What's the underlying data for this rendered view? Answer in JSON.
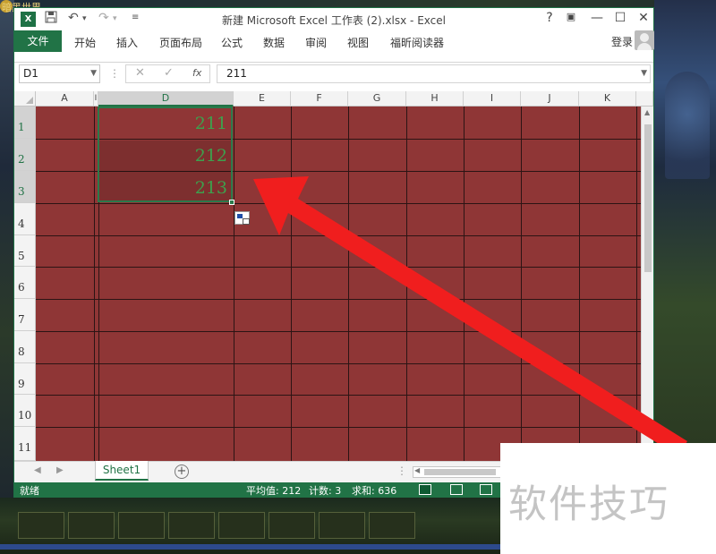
{
  "desktop": {
    "title_fragment": "暗黑世界"
  },
  "window": {
    "title": "新建 Microsoft Excel 工作表 (2).xlsx - Excel",
    "app_icon": "X",
    "help": "?",
    "controls": {
      "minimize": "—",
      "maximize": "☐",
      "close": "✕"
    }
  },
  "ribbon": {
    "file": "文件",
    "tabs": [
      "开始",
      "插入",
      "页面布局",
      "公式",
      "数据",
      "审阅",
      "视图",
      "福昕阅读器"
    ],
    "login": "登录"
  },
  "formula_bar": {
    "name_box": "D1",
    "cancel": "✕",
    "enter": "✓",
    "fx": "fx",
    "value": "211"
  },
  "grid": {
    "columns": [
      "A",
      "I",
      "D",
      "E",
      "F",
      "G",
      "H",
      "I",
      "J",
      "K"
    ],
    "selected_column": "D",
    "rows": [
      "1",
      "2",
      "3",
      "4",
      "5",
      "6",
      "7",
      "8",
      "9",
      "10",
      "11"
    ],
    "selected_rows": [
      "1",
      "2",
      "3"
    ],
    "cells": [
      {
        "ref": "D1",
        "value": "211"
      },
      {
        "ref": "D2",
        "value": "212"
      },
      {
        "ref": "D3",
        "value": "213"
      }
    ],
    "fill_color": "#8f3636",
    "text_color": "#3da04d"
  },
  "sheets": {
    "tabs": [
      "Sheet1"
    ],
    "active": "Sheet1",
    "add": "+"
  },
  "status": {
    "ready": "就绪",
    "average": "平均值: 212",
    "count": "计数: 3",
    "sum": "求和: 636"
  },
  "watermark": "软件技巧",
  "colors": {
    "excel_green": "#217346",
    "arrow_red": "#f01e1e"
  }
}
